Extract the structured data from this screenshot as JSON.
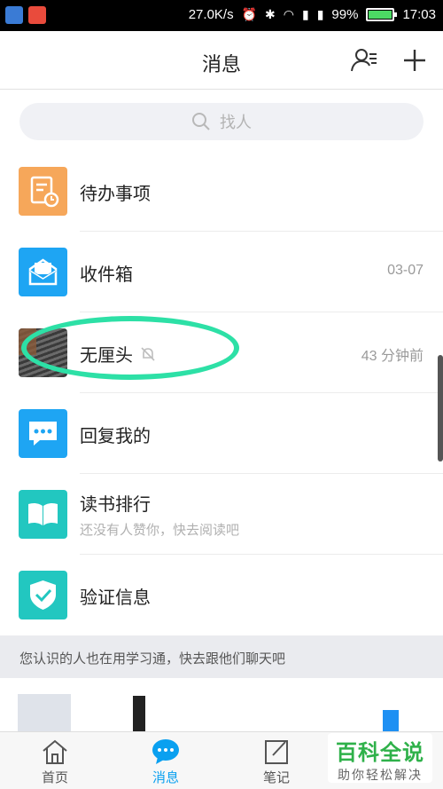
{
  "status_bar": {
    "net_speed": "27.0K/s",
    "battery": "99%",
    "battery_level": 0.99,
    "time": "17:03"
  },
  "header": {
    "title": "消息"
  },
  "search": {
    "placeholder": "找人"
  },
  "messages": [
    {
      "title": "待办事项",
      "subtitle": "",
      "meta": "",
      "icon": "todo-icon",
      "color": "#f6a75a"
    },
    {
      "title": "收件箱",
      "subtitle": "",
      "meta": "03-07",
      "icon": "inbox-icon",
      "color": "#1ea5f3"
    },
    {
      "title": "无厘头",
      "subtitle": "",
      "meta": "43 分钟前",
      "icon": "group-photo",
      "muted": true
    },
    {
      "title": "回复我的",
      "subtitle": "",
      "meta": "",
      "icon": "reply-icon",
      "color": "#1ea5f3"
    },
    {
      "title": "读书排行",
      "subtitle": "还没有人赞你，快去阅读吧",
      "meta": "",
      "icon": "book-icon",
      "color": "#22c7c0"
    },
    {
      "title": "验证信息",
      "subtitle": "",
      "meta": "",
      "icon": "verify-icon",
      "color": "#22c7c0"
    }
  ],
  "recommend": {
    "text": "您认识的人也在用学习通，快去跟他们聊天吧"
  },
  "tabbar": {
    "items": [
      {
        "label": "首页",
        "icon": "home-icon",
        "active": false
      },
      {
        "label": "消息",
        "icon": "chat-icon",
        "active": true
      },
      {
        "label": "笔记",
        "icon": "note-icon",
        "active": false
      }
    ]
  },
  "watermark": {
    "title": "百科全说",
    "subtitle": "助你轻松解决"
  },
  "colors": {
    "accent": "#0aa0f0",
    "highlight": "#2de0a6"
  }
}
